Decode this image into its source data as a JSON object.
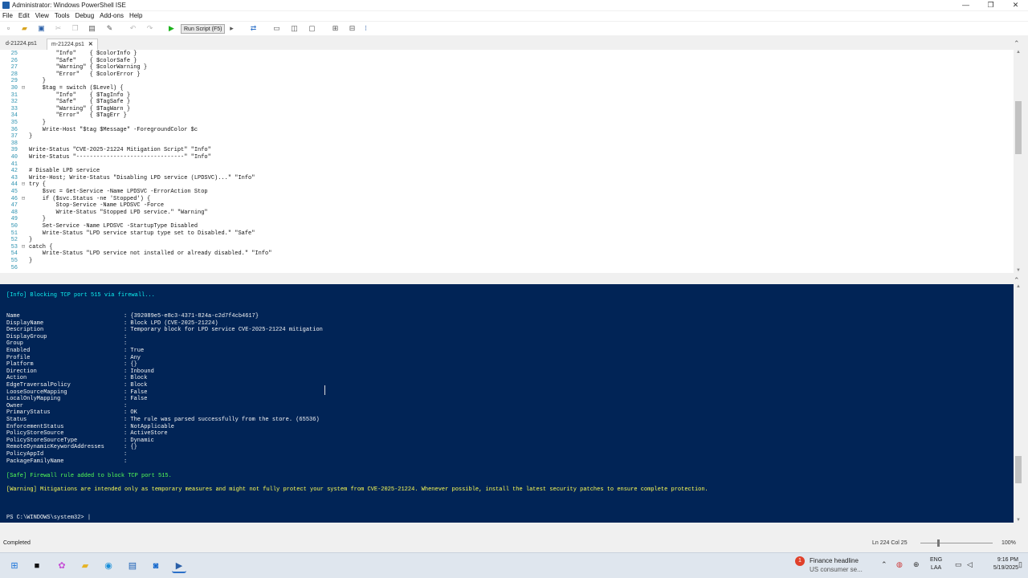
{
  "window": {
    "title": "Administrator: Windows PowerShell ISE",
    "controls": [
      "—",
      "❐",
      "✕"
    ]
  },
  "menu": [
    "File",
    "Edit",
    "View",
    "Tools",
    "Debug",
    "Add-ons",
    "Help"
  ],
  "toolbar": {
    "run_script_label": "Run Script (F5)"
  },
  "tabs": [
    {
      "label": "d-21224.ps1",
      "active": false
    },
    {
      "label": "m-21224.ps1",
      "active": true,
      "close": "✕"
    }
  ],
  "editor": {
    "lines": [
      {
        "num": "25",
        "fold": "",
        "text": "        \"Info\"    { $colorInfo }"
      },
      {
        "num": "26",
        "fold": "",
        "text": "        \"Safe\"    { $colorSafe }"
      },
      {
        "num": "27",
        "fold": "",
        "text": "        \"Warning\" { $colorWarning }"
      },
      {
        "num": "28",
        "fold": "",
        "text": "        \"Error\"   { $colorError }"
      },
      {
        "num": "29",
        "fold": "",
        "text": "    }"
      },
      {
        "num": "30",
        "fold": "⊟",
        "text": "    $tag = switch ($Level) {"
      },
      {
        "num": "31",
        "fold": "",
        "text": "        \"Info\"    { $TagInfo }"
      },
      {
        "num": "32",
        "fold": "",
        "text": "        \"Safe\"    { $TagSafe }"
      },
      {
        "num": "33",
        "fold": "",
        "text": "        \"Warning\" { $TagWarn }"
      },
      {
        "num": "34",
        "fold": "",
        "text": "        \"Error\"   { $TagErr }"
      },
      {
        "num": "35",
        "fold": "",
        "text": "    }"
      },
      {
        "num": "36",
        "fold": "",
        "text": "    Write-Host \"$tag $Message\" -ForegroundColor $c"
      },
      {
        "num": "37",
        "fold": "",
        "text": "}"
      },
      {
        "num": "38",
        "fold": "",
        "text": ""
      },
      {
        "num": "39",
        "fold": "",
        "text": "Write-Status \"CVE-2025-21224 Mitigation Script\" \"Info\""
      },
      {
        "num": "40",
        "fold": "",
        "text": "Write-Status \"--------------------------------\" \"Info\""
      },
      {
        "num": "41",
        "fold": "",
        "text": ""
      },
      {
        "num": "42",
        "fold": "",
        "text": "# Disable LPD service"
      },
      {
        "num": "43",
        "fold": "",
        "text": "Write-Host; Write-Status \"Disabling LPD service (LPDSVC)...\" \"Info\""
      },
      {
        "num": "44",
        "fold": "⊟",
        "text": "try {"
      },
      {
        "num": "45",
        "fold": "",
        "text": "    $svc = Get-Service -Name LPDSVC -ErrorAction Stop"
      },
      {
        "num": "46",
        "fold": "⊟",
        "text": "    if ($svc.Status -ne 'Stopped') {"
      },
      {
        "num": "47",
        "fold": "",
        "text": "        Stop-Service -Name LPDSVC -Force"
      },
      {
        "num": "48",
        "fold": "",
        "text": "        Write-Status \"Stopped LPD service.\" \"Warning\""
      },
      {
        "num": "49",
        "fold": "",
        "text": "    }"
      },
      {
        "num": "50",
        "fold": "",
        "text": "    Set-Service -Name LPDSVC -StartupType Disabled"
      },
      {
        "num": "51",
        "fold": "",
        "text": "    Write-Status \"LPD service startup type set to Disabled.\" \"Safe\""
      },
      {
        "num": "52",
        "fold": "",
        "text": "}"
      },
      {
        "num": "53",
        "fold": "⊟",
        "text": "catch {"
      },
      {
        "num": "54",
        "fold": "",
        "text": "    Write-Status \"LPD service not installed or already disabled.\" \"Info\""
      },
      {
        "num": "55",
        "fold": "",
        "text": "}"
      },
      {
        "num": "56",
        "fold": "",
        "text": ""
      }
    ]
  },
  "console": {
    "header": "[Info] Blocking TCP port 515 via firewall...",
    "properties": [
      {
        "key": "Name",
        "value": ": {392089e5-e8c3-4371-824a-c2d7f4cb4617}"
      },
      {
        "key": "DisplayName",
        "value": ": Block LPD (CVE-2025-21224)"
      },
      {
        "key": "Description",
        "value": ": Temporary block for LPD service CVE-2025-21224 mitigation"
      },
      {
        "key": "DisplayGroup",
        "value": ":"
      },
      {
        "key": "Group",
        "value": ":"
      },
      {
        "key": "Enabled",
        "value": ": True"
      },
      {
        "key": "Profile",
        "value": ": Any"
      },
      {
        "key": "Platform",
        "value": ": {}"
      },
      {
        "key": "Direction",
        "value": ": Inbound"
      },
      {
        "key": "Action",
        "value": ": Block"
      },
      {
        "key": "EdgeTraversalPolicy",
        "value": ": Block"
      },
      {
        "key": "LooseSourceMapping",
        "value": ": False"
      },
      {
        "key": "LocalOnlyMapping",
        "value": ": False"
      },
      {
        "key": "Owner",
        "value": ":"
      },
      {
        "key": "PrimaryStatus",
        "value": ": OK"
      },
      {
        "key": "Status",
        "value": ": The rule was parsed successfully from the store. (65536)"
      },
      {
        "key": "EnforcementStatus",
        "value": ": NotApplicable"
      },
      {
        "key": "PolicyStoreSource",
        "value": ": ActiveStore"
      },
      {
        "key": "PolicyStoreSourceType",
        "value": ": Dynamic"
      },
      {
        "key": "RemoteDynamicKeywordAddresses",
        "value": ": {}"
      },
      {
        "key": "PolicyAppId",
        "value": ":"
      },
      {
        "key": "PackageFamilyName",
        "value": ":"
      }
    ],
    "safe_line": "[Safe] Firewall rule added to block TCP port 515.",
    "warning_line": "[Warning] Mitigations are intended only as temporary measures and might not fully protect your system from CVE-2025-21224. Whenever possible, install the latest security patches to ensure complete protection.",
    "prompt": "PS C:\\WINDOWS\\system32> |"
  },
  "statusbar": {
    "status": "Completed",
    "position": "Ln 224  Col 25",
    "zoom": "100%"
  },
  "taskbar": {
    "news_title": "Finance headline",
    "news_sub": "US consumer se...",
    "news_badge": "1",
    "lang_top": "ENG",
    "lang_bottom": "LAA",
    "time": "9:16 PM",
    "date": "5/19/2025"
  },
  "colors": {
    "console_bg": "#012456",
    "info": "#0ef0f0",
    "safe": "#55ff55",
    "warning": "#ffff55"
  }
}
